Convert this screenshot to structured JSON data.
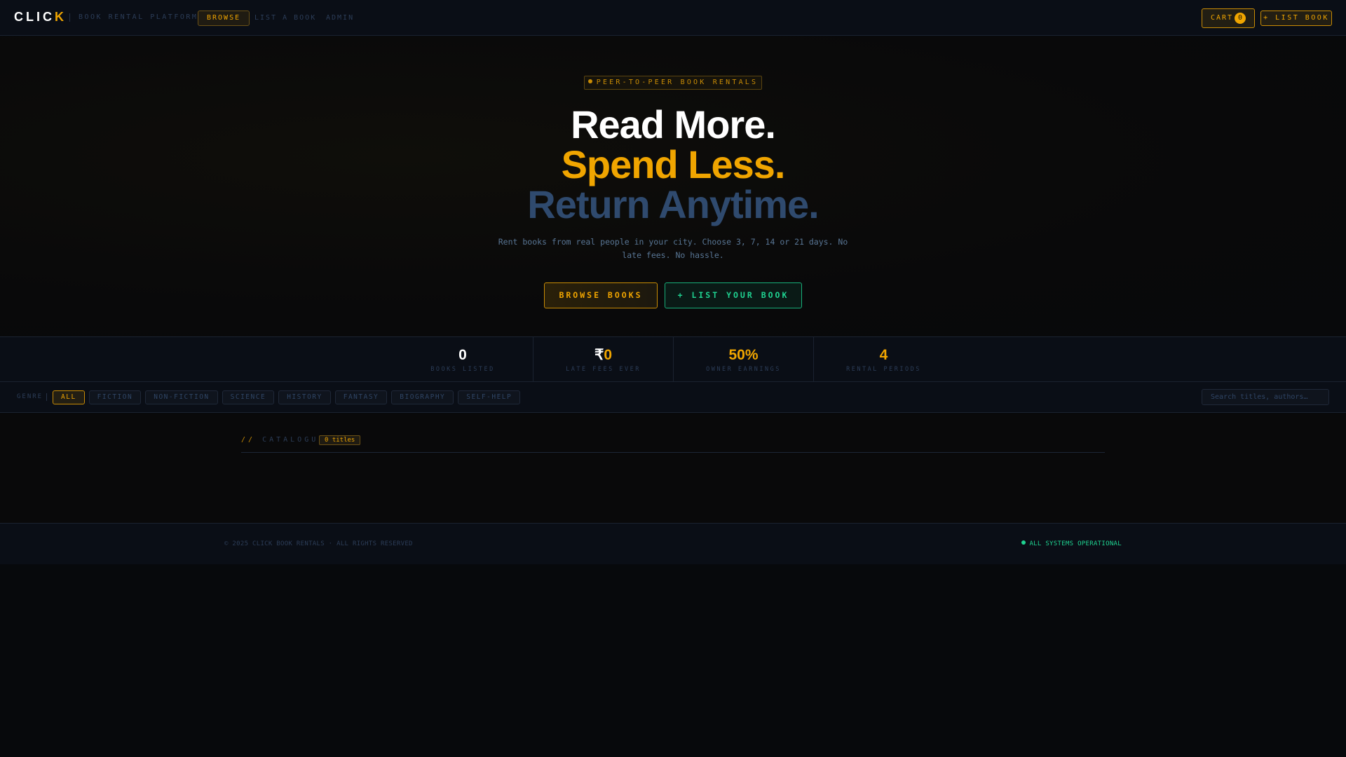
{
  "nav": {
    "logo_main": "CLIC",
    "logo_accent": "K",
    "tagline": "BOOK RENTAL PLATFORM",
    "links": [
      {
        "label": "BROWSE",
        "active": true
      },
      {
        "label": "LIST A BOOK"
      },
      {
        "label": "ADMIN"
      }
    ],
    "cart_label": "CART",
    "cart_count": "0",
    "list_book_label": "+ LIST BOOK"
  },
  "hero": {
    "badge": "PEER-TO-PEER BOOK RENTALS",
    "line1": "Read More.",
    "line2": "Spend Less.",
    "line3": "Return Anytime.",
    "subtitle": "Rent books from real people in your city. Choose 3, 7, 14 or 21 days. No late fees. No hassle.",
    "browse_button": "BROWSE BOOKS",
    "list_button": "+ LIST YOUR BOOK"
  },
  "stats": [
    {
      "value": "0",
      "label": "BOOKS LISTED"
    },
    {
      "prefix": "₹",
      "value": "0",
      "label": "LATE FEES EVER"
    },
    {
      "value": "50%",
      "label": "OWNER EARNINGS"
    },
    {
      "value": "4",
      "label": "RENTAL PERIODS"
    }
  ],
  "filters": {
    "label": "GENRE",
    "genres": [
      "ALL",
      "FICTION",
      "NON-FICTION",
      "SCIENCE",
      "HISTORY",
      "FANTASY",
      "BIOGRAPHY",
      "SELF-HELP"
    ],
    "search_placeholder": "Search titles, authors…"
  },
  "catalogue": {
    "prefix": "//",
    "title": "CATALOGUE",
    "count": "0 titles"
  },
  "footer": {
    "copyright": "© 2025 CLICK BOOK RENTALS · ALL RIGHTS RESERVED",
    "status": "ALL SYSTEMS OPERATIONAL"
  },
  "colors": {
    "accent": "#f0a500",
    "success": "#1fd391",
    "muted": "#2c3d58",
    "heading_blue": "#2f4a6e"
  }
}
